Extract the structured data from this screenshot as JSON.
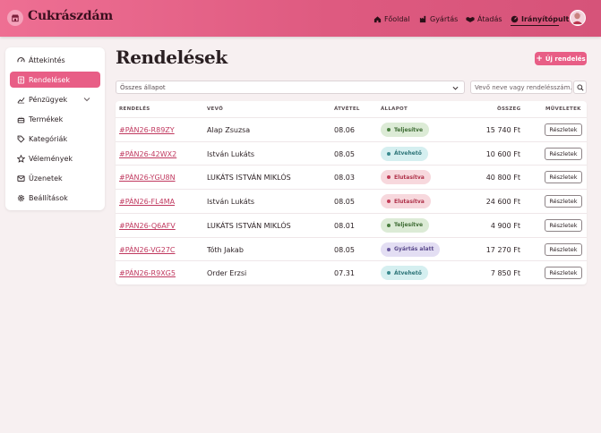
{
  "brand": {
    "name": "Cukrászdám",
    "icon": "storefront-icon"
  },
  "nav": [
    {
      "label": "Főoldal",
      "icon": "home-icon",
      "active": false
    },
    {
      "label": "Gyártás",
      "icon": "factory-icon",
      "active": false
    },
    {
      "label": "Átadás",
      "icon": "handshake-icon",
      "active": false
    },
    {
      "label": "Irányítópult",
      "icon": "dashboard-icon",
      "active": true
    }
  ],
  "sidebar": {
    "items": [
      {
        "label": "Áttekintés",
        "icon": "gauge-icon"
      },
      {
        "label": "Rendelések",
        "icon": "receipt-icon",
        "active": true
      },
      {
        "label": "Pénzügyek",
        "icon": "chart-line-icon",
        "expandable": true
      },
      {
        "label": "Termékek",
        "icon": "cake-icon"
      },
      {
        "label": "Kategóriák",
        "icon": "tag-icon"
      },
      {
        "label": "Vélemények",
        "icon": "star-icon"
      },
      {
        "label": "Üzenetek",
        "icon": "envelope-icon"
      },
      {
        "label": "Beállítások",
        "icon": "gear-icon"
      }
    ]
  },
  "page": {
    "title": "Rendelések",
    "new_order_label": "Új rendelés"
  },
  "filters": {
    "status_value": "Összes állapot",
    "search_placeholder": "Vevő neve vagy rendelésszám...",
    "search_value": ""
  },
  "table": {
    "headers": {
      "order": "RENDELÉS",
      "customer": "VEVŐ",
      "pickup": "ÁTVÉTEL",
      "status": "ÁLLAPOT",
      "total": "ÖSSZEG",
      "actions": "MŰVELETEK"
    },
    "details_label": "Részletek",
    "rows": [
      {
        "order": "#PÁN26-R89ZY",
        "customer": "Alap Zsuzsa",
        "pickup": "08.06",
        "status": "Teljesítve",
        "status_kind": "done",
        "total": "15 740 Ft"
      },
      {
        "order": "#PÁN26-42WX2",
        "customer": "István Lukáts",
        "pickup": "08.05",
        "status": "Átvehető",
        "status_kind": "ready",
        "total": "10 600 Ft"
      },
      {
        "order": "#PÁN26-YGU8N",
        "customer": "LUKÁTS ISTVÁN MIKLÓS",
        "pickup": "08.03",
        "status": "Elutasítva",
        "status_kind": "rejected",
        "total": "40 800 Ft"
      },
      {
        "order": "#PÁN26-FL4MA",
        "customer": "István Lukáts",
        "pickup": "08.05",
        "status": "Elutasítva",
        "status_kind": "rejected",
        "total": "24 600 Ft"
      },
      {
        "order": "#PÁN26-Q6AFV",
        "customer": "LUKÁTS ISTVÁN MIKLÓS",
        "pickup": "08.01",
        "status": "Teljesítve",
        "status_kind": "done",
        "total": "4 900 Ft"
      },
      {
        "order": "#PÁN26-VG27C",
        "customer": "Tóth Jakab",
        "pickup": "08.05",
        "status": "Gyártás alatt",
        "status_kind": "production",
        "total": "17 270 Ft"
      },
      {
        "order": "#PÁN26-R9XG5",
        "customer": "Order Erzsi",
        "pickup": "07.31",
        "status": "Átvehető",
        "status_kind": "ready",
        "total": "7 850 Ft"
      }
    ]
  },
  "colors": {
    "accent": "#e85e86",
    "header_gradient_start": "#ee6f93",
    "header_gradient_end": "#d65379",
    "status": {
      "done": {
        "bg": "#dcebd6",
        "fg": "#3d6b33",
        "dot": "#4a7f3f"
      },
      "ready": {
        "bg": "#d5eff0",
        "fg": "#2d7478",
        "dot": "#3a8a8f"
      },
      "rejected": {
        "bg": "#f7d8dd",
        "fg": "#b0344c",
        "dot": "#c23c57"
      },
      "production": {
        "bg": "#e3def3",
        "fg": "#5a4a8c",
        "dot": "#6a5aa0"
      }
    }
  }
}
